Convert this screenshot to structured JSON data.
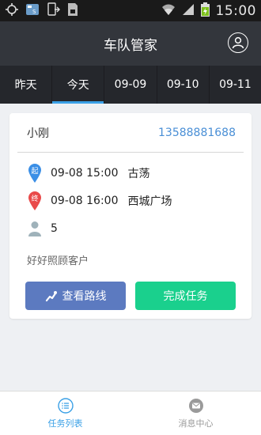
{
  "status_bar": {
    "time": "15:00"
  },
  "header": {
    "title": "车队管家"
  },
  "tabs": [
    {
      "label": "昨天",
      "active": false
    },
    {
      "label": "今天",
      "active": true
    },
    {
      "label": "09-09",
      "active": false
    },
    {
      "label": "09-10",
      "active": false
    },
    {
      "label": "09-11",
      "active": false
    }
  ],
  "task": {
    "customer_name": "小刚",
    "phone": "13588881688",
    "start": {
      "badge": "起",
      "time": "09-08 15:00",
      "place": "古荡"
    },
    "end": {
      "badge": "终",
      "time": "09-08 16:00",
      "place": "西城广场"
    },
    "passengers": "5",
    "note": "好好照顾客户",
    "route_button": "查看路线",
    "complete_button": "完成任务"
  },
  "bottom_nav": [
    {
      "label": "任务列表",
      "active": true,
      "icon": "list-icon"
    },
    {
      "label": "消息中心",
      "active": false,
      "icon": "message-icon"
    }
  ],
  "colors": {
    "accent": "#3aa0e6",
    "header_bg": "#33363c",
    "tabs_bg": "#25272c",
    "route_button": "#5c7ac0",
    "complete_button": "#1ad08d",
    "start_pin": "#3b8fe6",
    "end_pin": "#e94a4a"
  }
}
